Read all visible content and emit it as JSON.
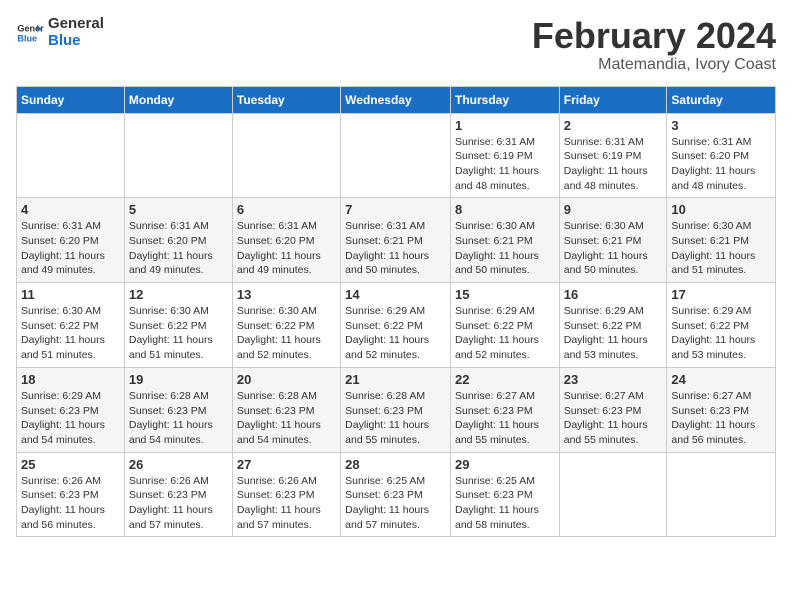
{
  "logo": {
    "line1": "General",
    "line2": "Blue"
  },
  "title": "February 2024",
  "subtitle": "Matemandia, Ivory Coast",
  "weekdays": [
    "Sunday",
    "Monday",
    "Tuesday",
    "Wednesday",
    "Thursday",
    "Friday",
    "Saturday"
  ],
  "weeks": [
    [
      {
        "day": "",
        "info": ""
      },
      {
        "day": "",
        "info": ""
      },
      {
        "day": "",
        "info": ""
      },
      {
        "day": "",
        "info": ""
      },
      {
        "day": "1",
        "info": "Sunrise: 6:31 AM\nSunset: 6:19 PM\nDaylight: 11 hours\nand 48 minutes."
      },
      {
        "day": "2",
        "info": "Sunrise: 6:31 AM\nSunset: 6:19 PM\nDaylight: 11 hours\nand 48 minutes."
      },
      {
        "day": "3",
        "info": "Sunrise: 6:31 AM\nSunset: 6:20 PM\nDaylight: 11 hours\nand 48 minutes."
      }
    ],
    [
      {
        "day": "4",
        "info": "Sunrise: 6:31 AM\nSunset: 6:20 PM\nDaylight: 11 hours\nand 49 minutes."
      },
      {
        "day": "5",
        "info": "Sunrise: 6:31 AM\nSunset: 6:20 PM\nDaylight: 11 hours\nand 49 minutes."
      },
      {
        "day": "6",
        "info": "Sunrise: 6:31 AM\nSunset: 6:20 PM\nDaylight: 11 hours\nand 49 minutes."
      },
      {
        "day": "7",
        "info": "Sunrise: 6:31 AM\nSunset: 6:21 PM\nDaylight: 11 hours\nand 50 minutes."
      },
      {
        "day": "8",
        "info": "Sunrise: 6:30 AM\nSunset: 6:21 PM\nDaylight: 11 hours\nand 50 minutes."
      },
      {
        "day": "9",
        "info": "Sunrise: 6:30 AM\nSunset: 6:21 PM\nDaylight: 11 hours\nand 50 minutes."
      },
      {
        "day": "10",
        "info": "Sunrise: 6:30 AM\nSunset: 6:21 PM\nDaylight: 11 hours\nand 51 minutes."
      }
    ],
    [
      {
        "day": "11",
        "info": "Sunrise: 6:30 AM\nSunset: 6:22 PM\nDaylight: 11 hours\nand 51 minutes."
      },
      {
        "day": "12",
        "info": "Sunrise: 6:30 AM\nSunset: 6:22 PM\nDaylight: 11 hours\nand 51 minutes."
      },
      {
        "day": "13",
        "info": "Sunrise: 6:30 AM\nSunset: 6:22 PM\nDaylight: 11 hours\nand 52 minutes."
      },
      {
        "day": "14",
        "info": "Sunrise: 6:29 AM\nSunset: 6:22 PM\nDaylight: 11 hours\nand 52 minutes."
      },
      {
        "day": "15",
        "info": "Sunrise: 6:29 AM\nSunset: 6:22 PM\nDaylight: 11 hours\nand 52 minutes."
      },
      {
        "day": "16",
        "info": "Sunrise: 6:29 AM\nSunset: 6:22 PM\nDaylight: 11 hours\nand 53 minutes."
      },
      {
        "day": "17",
        "info": "Sunrise: 6:29 AM\nSunset: 6:22 PM\nDaylight: 11 hours\nand 53 minutes."
      }
    ],
    [
      {
        "day": "18",
        "info": "Sunrise: 6:29 AM\nSunset: 6:23 PM\nDaylight: 11 hours\nand 54 minutes."
      },
      {
        "day": "19",
        "info": "Sunrise: 6:28 AM\nSunset: 6:23 PM\nDaylight: 11 hours\nand 54 minutes."
      },
      {
        "day": "20",
        "info": "Sunrise: 6:28 AM\nSunset: 6:23 PM\nDaylight: 11 hours\nand 54 minutes."
      },
      {
        "day": "21",
        "info": "Sunrise: 6:28 AM\nSunset: 6:23 PM\nDaylight: 11 hours\nand 55 minutes."
      },
      {
        "day": "22",
        "info": "Sunrise: 6:27 AM\nSunset: 6:23 PM\nDaylight: 11 hours\nand 55 minutes."
      },
      {
        "day": "23",
        "info": "Sunrise: 6:27 AM\nSunset: 6:23 PM\nDaylight: 11 hours\nand 55 minutes."
      },
      {
        "day": "24",
        "info": "Sunrise: 6:27 AM\nSunset: 6:23 PM\nDaylight: 11 hours\nand 56 minutes."
      }
    ],
    [
      {
        "day": "25",
        "info": "Sunrise: 6:26 AM\nSunset: 6:23 PM\nDaylight: 11 hours\nand 56 minutes."
      },
      {
        "day": "26",
        "info": "Sunrise: 6:26 AM\nSunset: 6:23 PM\nDaylight: 11 hours\nand 57 minutes."
      },
      {
        "day": "27",
        "info": "Sunrise: 6:26 AM\nSunset: 6:23 PM\nDaylight: 11 hours\nand 57 minutes."
      },
      {
        "day": "28",
        "info": "Sunrise: 6:25 AM\nSunset: 6:23 PM\nDaylight: 11 hours\nand 57 minutes."
      },
      {
        "day": "29",
        "info": "Sunrise: 6:25 AM\nSunset: 6:23 PM\nDaylight: 11 hours\nand 58 minutes."
      },
      {
        "day": "",
        "info": ""
      },
      {
        "day": "",
        "info": ""
      }
    ]
  ]
}
